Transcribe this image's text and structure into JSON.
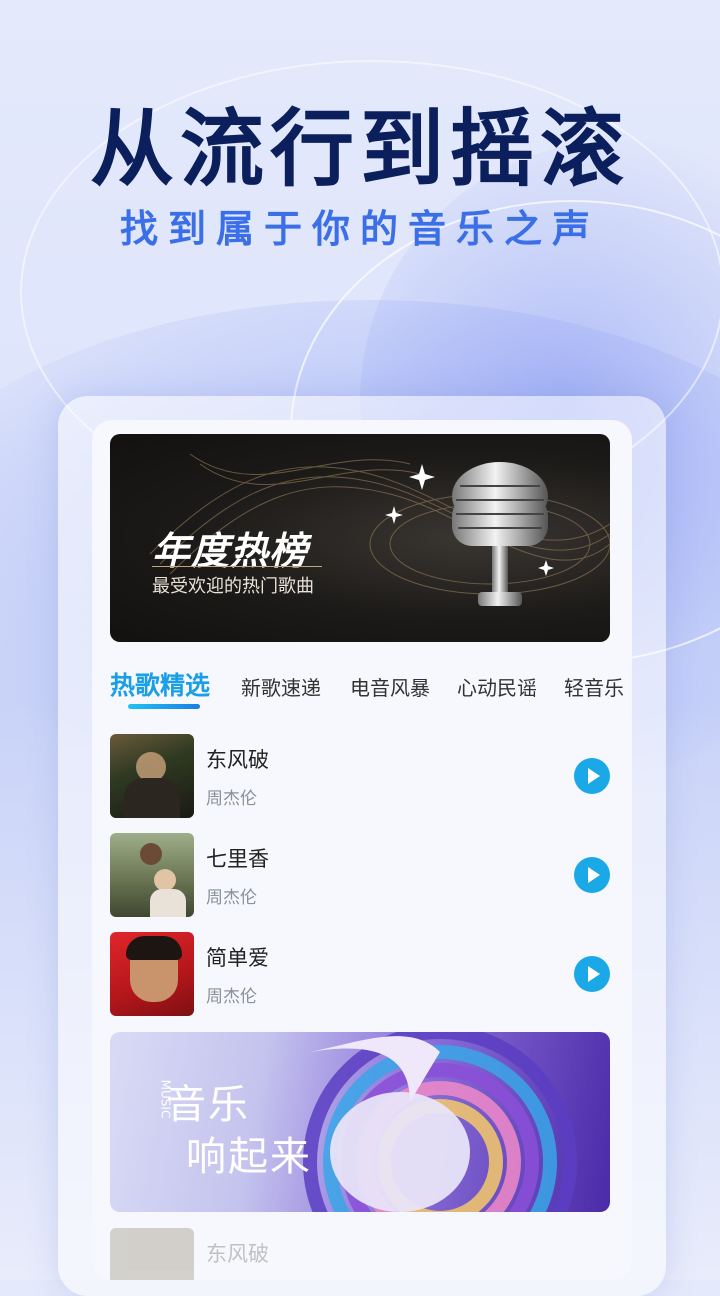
{
  "hero": {
    "title": "从流行到摇滚",
    "subtitle": "找到属于你的音乐之声"
  },
  "top_banner": {
    "title": "年度热榜",
    "subtitle": "最受欢迎的热门歌曲"
  },
  "tabs": [
    {
      "label": "热歌精选",
      "active": true
    },
    {
      "label": "新歌速递"
    },
    {
      "label": "电音风暴"
    },
    {
      "label": "心动民谣"
    },
    {
      "label": "轻音乐"
    }
  ],
  "songs": [
    {
      "title": "东风破",
      "artist": "周杰伦"
    },
    {
      "title": "七里香",
      "artist": "周杰伦"
    },
    {
      "title": "简单爱",
      "artist": "周杰伦"
    }
  ],
  "bottom_banner": {
    "line1": "音乐",
    "line2": "响起来",
    "latin": "MUSIC"
  },
  "ghost_song": {
    "title": "东风破"
  },
  "colors": {
    "headline": "#0b1f5c",
    "subline": "#3b6fe8",
    "accent": "#1a9ee6",
    "play": "#1aa8e6"
  }
}
